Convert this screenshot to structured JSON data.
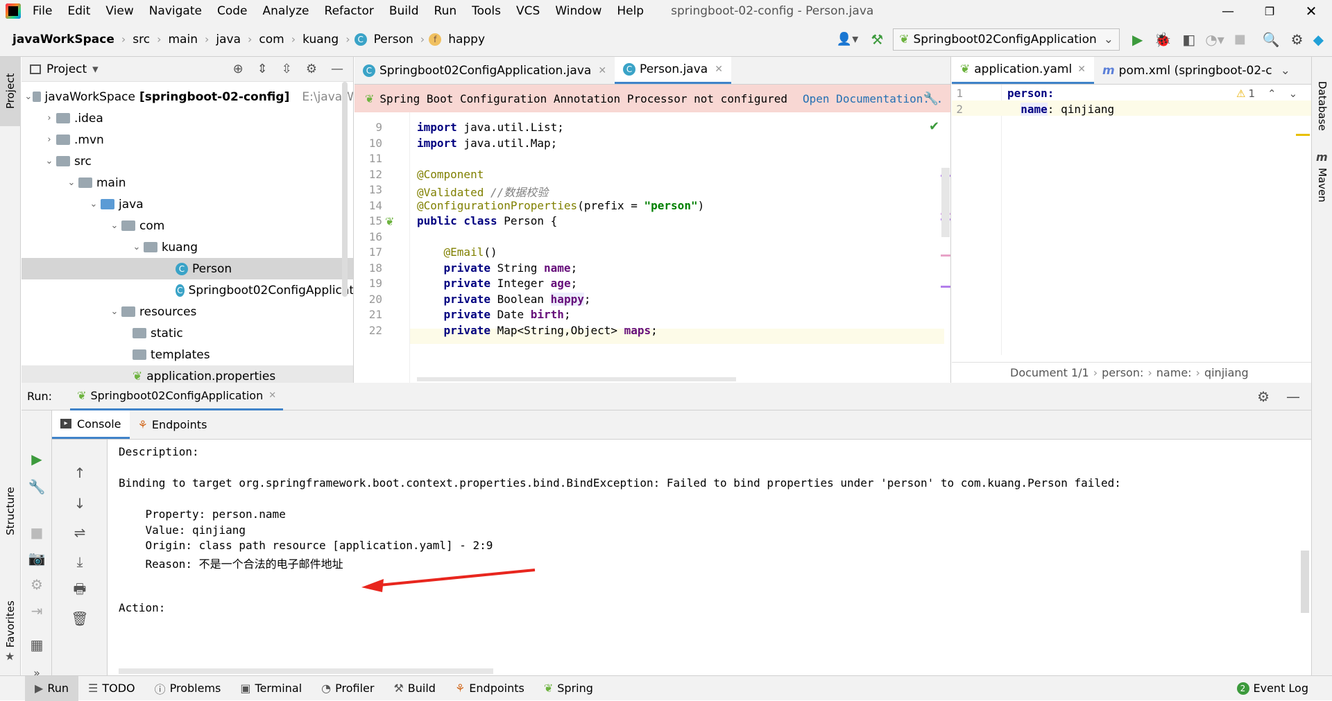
{
  "window": {
    "title": "springboot-02-config - Person.java"
  },
  "menu": [
    "File",
    "Edit",
    "View",
    "Navigate",
    "Code",
    "Analyze",
    "Refactor",
    "Build",
    "Run",
    "Tools",
    "VCS",
    "Window",
    "Help"
  ],
  "breadcrumb": [
    "javaWorkSpace",
    "src",
    "main",
    "java",
    "com",
    "kuang",
    "Person",
    "happy"
  ],
  "run_config": "Springboot02ConfigApplication",
  "project": {
    "header": "Project",
    "root_name": "javaWorkSpace",
    "root_module": "[springboot-02-config]",
    "root_path": "E:\\javaW",
    "items": [
      ".idea",
      ".mvn",
      "src",
      "main",
      "java",
      "com",
      "kuang",
      "Person",
      "Springboot02ConfigApplicat",
      "resources",
      "static",
      "templates",
      "application.properties"
    ]
  },
  "editor": {
    "tabs": [
      "Springboot02ConfigApplication.java",
      "Person.java"
    ],
    "banner": "Spring Boot Configuration Annotation Processor not configured",
    "banner_link": "Open Documentation...",
    "line_numbers": [
      "9",
      "10",
      "11",
      "12",
      "13",
      "14",
      "15",
      "16",
      "17",
      "18",
      "19",
      "20",
      "21",
      "22"
    ]
  },
  "yaml": {
    "tabs": [
      "application.yaml",
      "pom.xml (springboot-02-c"
    ],
    "line_numbers": [
      "1",
      "2"
    ],
    "key1": "person:",
    "key2": "name",
    "value2": "qinjiang",
    "warning_count": "1",
    "status": [
      "Document 1/1",
      "person:",
      "name:",
      "qinjiang"
    ]
  },
  "run": {
    "label": "Run:",
    "tab": "Springboot02ConfigApplication",
    "subtabs": [
      "Console",
      "Endpoints"
    ],
    "lines": [
      "Description:",
      "Binding to target org.springframework.boot.context.properties.bind.BindException: Failed to bind properties under 'person' to com.kuang.Person failed:",
      "    Property: person.name",
      "    Value: qinjiang",
      "    Origin: class path resource [application.yaml] - 2:9",
      "    Reason: 不是一个合法的电子邮件地址",
      "Action:"
    ]
  },
  "left_strip": [
    "Project",
    "Structure",
    "Favorites"
  ],
  "right_strip": [
    "Database",
    "Maven"
  ],
  "bottom": {
    "tools": [
      "Run",
      "TODO",
      "Problems",
      "Terminal",
      "Profiler",
      "Build",
      "Endpoints",
      "Spring"
    ],
    "event_log": "Event Log",
    "event_count": "2"
  },
  "colors": {
    "accent": "#4083c9",
    "banner_bg": "#f8d7d3",
    "arrow": "#e8261e"
  }
}
